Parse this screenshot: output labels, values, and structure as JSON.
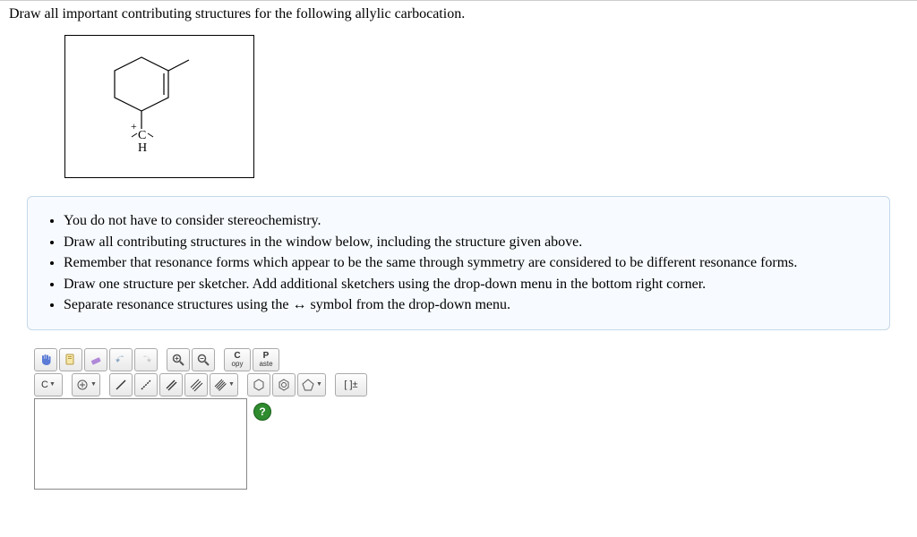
{
  "question": "Draw all important contributing structures for the following allylic carbocation.",
  "structure": {
    "cation_label_c": "C",
    "cation_label_h": "H",
    "cation_charge": "+"
  },
  "instructions": [
    "You do not have to consider stereochemistry.",
    "Draw all contributing structures in the window below, including the structure given above.",
    "Remember that resonance forms which appear to be the same through symmetry are considered to be different resonance forms.",
    "Draw one structure per sketcher. Add additional sketchers using the drop-down menu in the bottom right corner.",
    "Separate resonance structures using the ↔ symbol from the drop-down menu."
  ],
  "toolbar": {
    "row1": {
      "copy_top": "C",
      "copy_bottom": "opy",
      "paste_top": "P",
      "paste_bottom": "aste"
    },
    "row2": {
      "element": "C",
      "charge": "[ ]±"
    },
    "help": "?"
  }
}
